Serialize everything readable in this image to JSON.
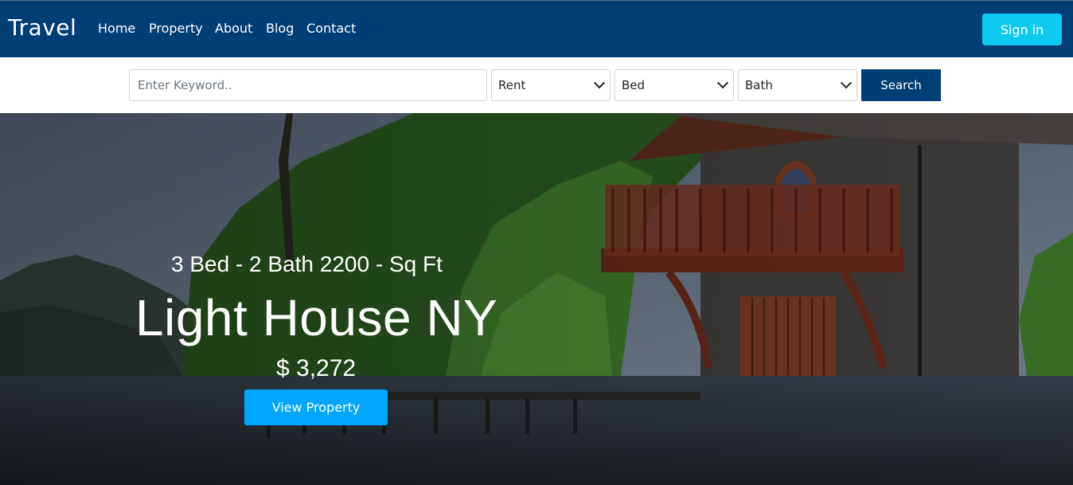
{
  "nav": {
    "brand": "Travel",
    "links": [
      "Home",
      "Property",
      "About",
      "Blog",
      "Contact"
    ],
    "signin_label": "Sign in"
  },
  "search": {
    "keyword_placeholder": "Enter Keyword..",
    "type_selected": "Rent",
    "bed_selected": "Bed",
    "bath_selected": "Bath",
    "button_label": "Search"
  },
  "hero": {
    "subtitle": "3 Bed - 2 Bath 2200 - Sq Ft",
    "title": "Light House NY",
    "price": "$ 3,272",
    "button_label": "View Property"
  },
  "colors": {
    "nav_bg": "#003e75",
    "signin_bg": "#0dcaf0",
    "search_btn_bg": "#003e75",
    "view_btn_bg": "#00a6ff"
  }
}
